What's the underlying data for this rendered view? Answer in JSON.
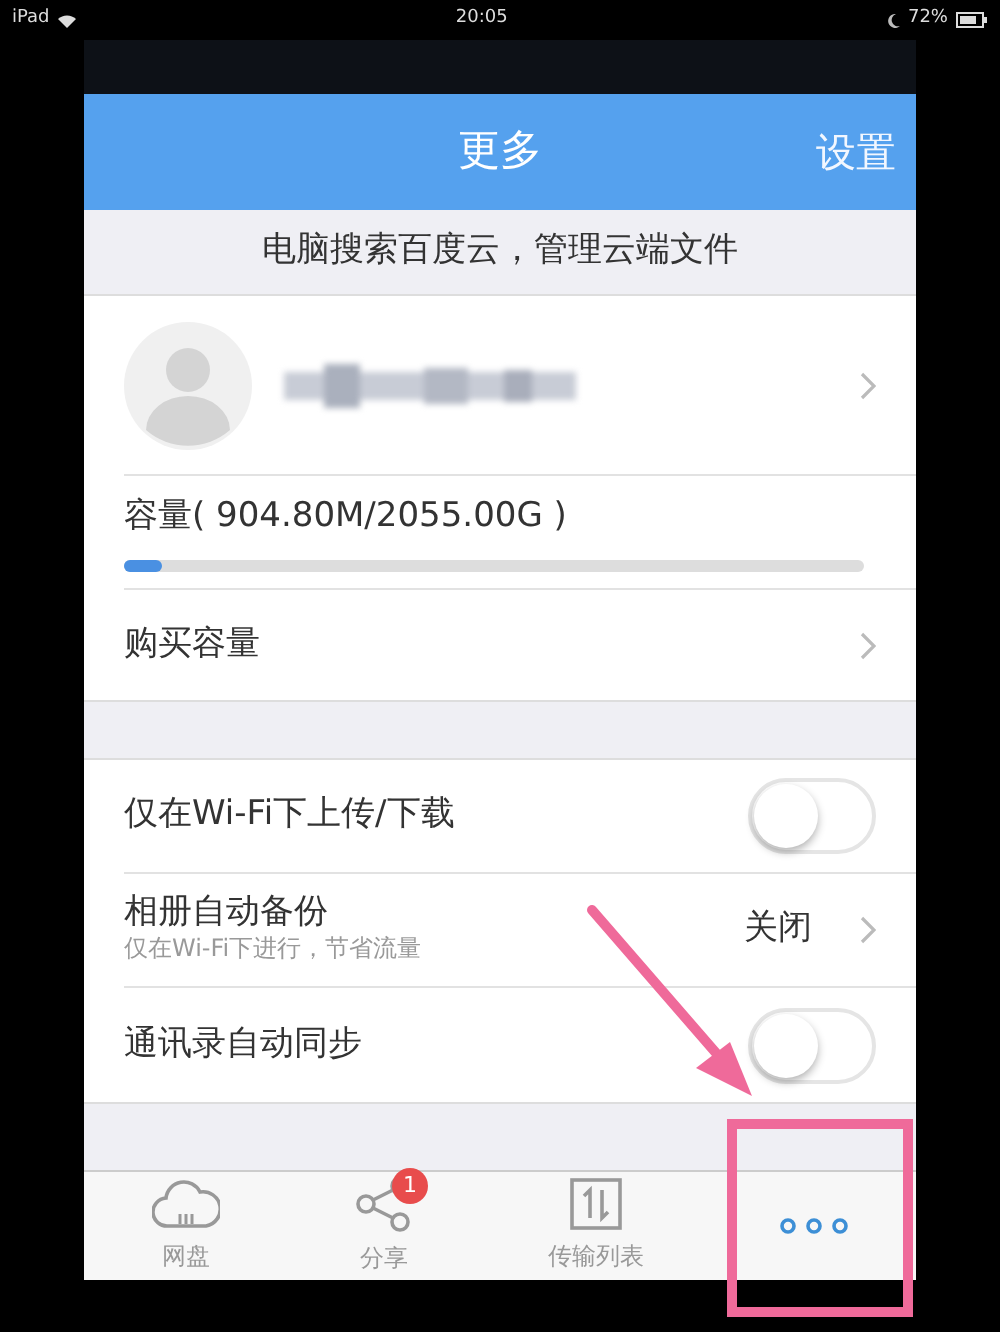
{
  "status_bar": {
    "device": "iPad",
    "time": "20:05",
    "battery": "72%"
  },
  "header": {
    "title": "更多",
    "action": "设置"
  },
  "banner": "电脑搜索百度云，管理云端文件",
  "account": {
    "capacity_label": "容量( 904.80M/2055.00G )",
    "level": 0.05
  },
  "buy": "购买容量",
  "settings": [
    {
      "kind": "toggle",
      "label": "仅在Wi-Fi下上传/下载",
      "on": false
    },
    {
      "kind": "link",
      "label": "相册自动备份",
      "sublabel": "仅在Wi-Fi下进行，节省流量",
      "value": "关闭"
    },
    {
      "kind": "toggle",
      "label": "通讯录自动同步",
      "on": false
    }
  ],
  "tabs": [
    {
      "kind": "cloud",
      "label": "网盘",
      "selected": false
    },
    {
      "kind": "share",
      "label": "分享",
      "badge": "1",
      "selected": false
    },
    {
      "kind": "transfer",
      "label": "传输列表",
      "selected": false
    },
    {
      "kind": "more",
      "selected": true
    }
  ]
}
